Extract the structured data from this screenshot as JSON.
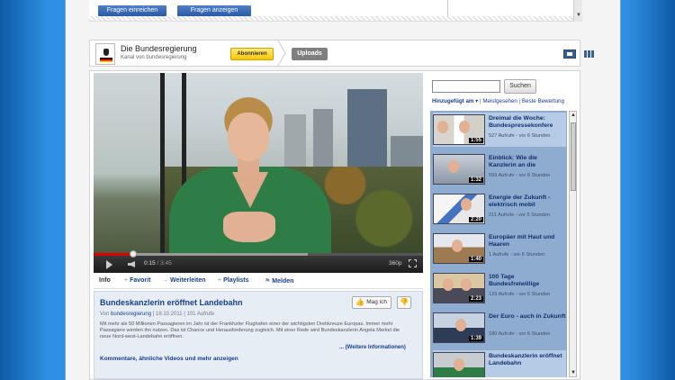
{
  "top_panel": {
    "buttons": [
      "Fragen einreichen",
      "Fragen anzeigen"
    ]
  },
  "channel": {
    "name": "Die Bundesregierung",
    "subtitle": "Kanal von bundesregierung",
    "subscribe_label": "Abonnieren",
    "uploads_label": "Uploads"
  },
  "player": {
    "time_current": "0:15",
    "time_total": "3:45",
    "progress_played": 0.12,
    "progress_loaded": 0.65,
    "quality_label": "360p"
  },
  "video_tabs": {
    "info": "Info",
    "favorite": "Favorit",
    "share": "Weiterleiten",
    "playlists": "Playlists",
    "report": "Melden"
  },
  "video": {
    "title": "Bundeskanzlerin eröffnet Landebahn",
    "like_label": "Mag ich",
    "meta_prefix": "Von",
    "uploader": "bundesregierung",
    "date": "18.10.2011",
    "views": "101 Aufrufe",
    "description": "Mit mehr als 50 Millionen Passagieren im Jahr ist der Frankfurter Flughafen einer der wichtigsten Drehkreuze Europas. Immer mehr Passagiere werden ihn nutzen. Das ist Chance und Herausforderung zugleich. Mit einer Rede wird Bundeskanzlerin Angela Merkel die neue Nord-west-Landebahn eröffnen.",
    "more_info": "... (Weitere Informationen)",
    "comments_link": "Kommentare, ähnliche Videos und mehr anzeigen"
  },
  "sidebar": {
    "search_placeholder": "",
    "search_button": "Suchen",
    "sort_active": "Hinzugefügt am ▾",
    "sort_options": [
      "Meistgesehen",
      "Beste Bewertung"
    ],
    "items": [
      {
        "title": "Dreimal die Woche: Bundespressekonfere",
        "meta": "527 Aufrufe - vor 6 Stunden",
        "duration": "1:55"
      },
      {
        "title": "Einblick: Wie die Kanzlerin an die",
        "meta": "593 Aufrufe - vor 6 Stunden",
        "duration": "1:32"
      },
      {
        "title": "Energie der Zukunft - elektrisch mobil",
        "meta": "211 Aufrufe - vor 5 Stunden",
        "duration": "2:20"
      },
      {
        "title": "Europäer mit Haut und Haaren",
        "meta": "1 Aufrufe - vor 6 Stunden",
        "duration": "1:40"
      },
      {
        "title": "100 Tage Bundesfreiwillige",
        "meta": "129 Aufrufe - vor 6 Stunden",
        "duration": "2:23"
      },
      {
        "title": "Der Euro - auch in Zukunft",
        "meta": "180 Aufrufe - vor 6 Stunden",
        "duration": "1:39"
      },
      {
        "title": "Bundeskanzlerin eröffnet Landebahn",
        "meta": "",
        "duration": ""
      }
    ]
  },
  "colors": {
    "link_blue": "#1a3e8c",
    "playlist_bg": "#8eaccf",
    "subscribe_yellow": "#f7c800",
    "progress_red": "#dd0000"
  }
}
